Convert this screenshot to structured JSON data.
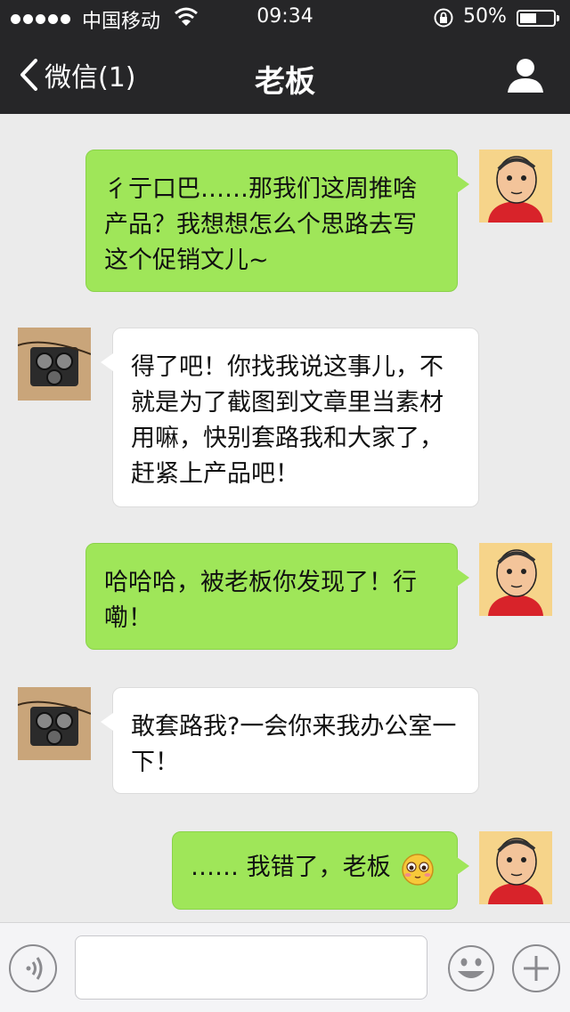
{
  "status_bar": {
    "carrier": "中国移动",
    "time": "09:34",
    "battery_percent": "50%"
  },
  "nav": {
    "back_label": "微信(1)",
    "title": "老板"
  },
  "messages": [
    {
      "sender": "me",
      "text": "彳亍口巴……那我们这周推啥产品？我想想怎么个思路去写这个促销文儿~"
    },
    {
      "sender": "boss",
      "text": "得了吧！你找我说这事儿，不就是为了截图到文章里当素材用嘛，快别套路我和大家了，赶紧上产品吧！"
    },
    {
      "sender": "me",
      "text": "哈哈哈，被老板你发现了！行嘞！"
    },
    {
      "sender": "boss",
      "text": "敢套路我?一会你来我办公室一下！"
    },
    {
      "sender": "me",
      "text": "…… 我错了，老板"
    }
  ],
  "input": {
    "value": "",
    "placeholder": ""
  },
  "colors": {
    "nav_bg": "#262628",
    "chat_bg": "#ebebeb",
    "my_bubble": "#9fe659",
    "their_bubble": "#ffffff"
  },
  "icons": {
    "back": "chevron-left-icon",
    "profile": "person-icon",
    "voice": "voice-icon",
    "emoji": "smiley-icon",
    "plus": "plus-icon"
  }
}
